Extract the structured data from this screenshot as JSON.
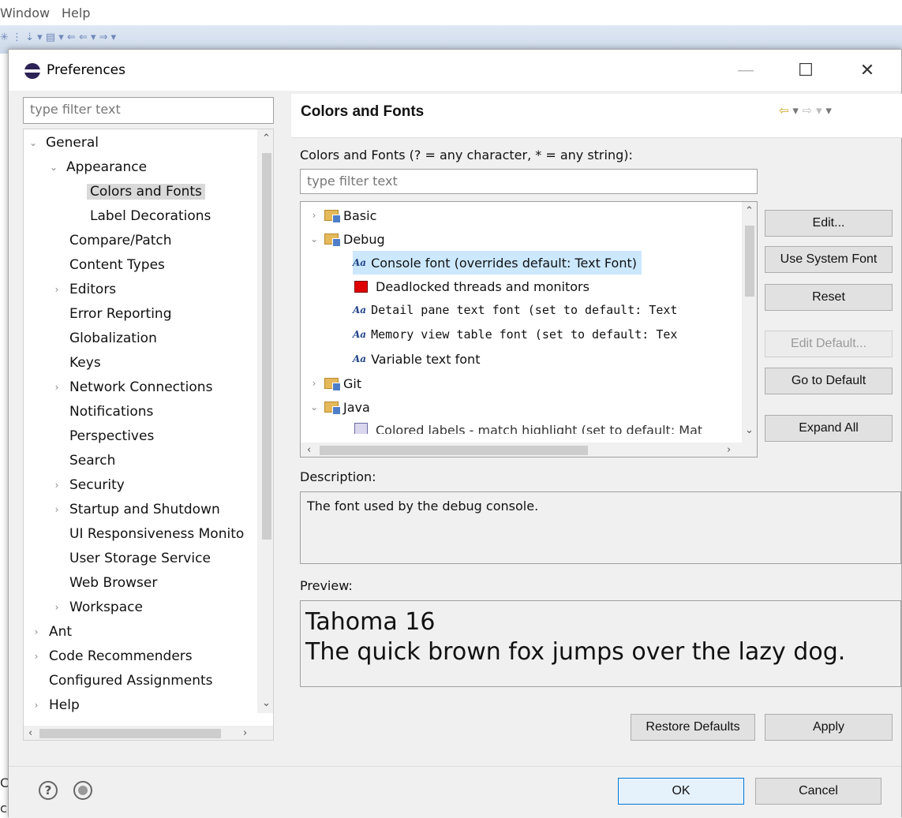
{
  "ide": {
    "menu": [
      "Window",
      "Help"
    ],
    "left_edge_letters": [
      "C",
      "c"
    ]
  },
  "dialog": {
    "title": "Preferences",
    "window_controls": [
      "minimize",
      "maximize",
      "close"
    ]
  },
  "left": {
    "filter_placeholder": "type filter text",
    "tree": [
      {
        "label": "General",
        "level": 0,
        "state": "expanded"
      },
      {
        "label": "Appearance",
        "level": 1,
        "state": "expanded"
      },
      {
        "label": "Colors and Fonts",
        "level": 2,
        "state": "leaf",
        "selected": true
      },
      {
        "label": "Label Decorations",
        "level": 2,
        "state": "leaf"
      },
      {
        "label": "Compare/Patch",
        "level": 1,
        "state": "leaf"
      },
      {
        "label": "Content Types",
        "level": 1,
        "state": "leaf"
      },
      {
        "label": "Editors",
        "level": 1,
        "state": "collapsed"
      },
      {
        "label": "Error Reporting",
        "level": 1,
        "state": "leaf"
      },
      {
        "label": "Globalization",
        "level": 1,
        "state": "leaf"
      },
      {
        "label": "Keys",
        "level": 1,
        "state": "leaf"
      },
      {
        "label": "Network Connections",
        "level": 1,
        "state": "collapsed"
      },
      {
        "label": "Notifications",
        "level": 1,
        "state": "leaf"
      },
      {
        "label": "Perspectives",
        "level": 1,
        "state": "leaf"
      },
      {
        "label": "Search",
        "level": 1,
        "state": "leaf"
      },
      {
        "label": "Security",
        "level": 1,
        "state": "collapsed"
      },
      {
        "label": "Startup and Shutdown",
        "level": 1,
        "state": "collapsed"
      },
      {
        "label": "UI Responsiveness Monito",
        "level": 1,
        "state": "leaf"
      },
      {
        "label": "User Storage Service",
        "level": 1,
        "state": "leaf"
      },
      {
        "label": "Web Browser",
        "level": 1,
        "state": "leaf"
      },
      {
        "label": "Workspace",
        "level": 1,
        "state": "collapsed"
      },
      {
        "label": "Ant",
        "level": 0,
        "state": "collapsed"
      },
      {
        "label": "Code Recommenders",
        "level": 0,
        "state": "collapsed"
      },
      {
        "label": "Configured Assignments",
        "level": 0,
        "state": "leaf"
      },
      {
        "label": "Help",
        "level": 0,
        "state": "collapsed"
      }
    ]
  },
  "right": {
    "title": "Colors and Fonts",
    "filter_label": "Colors and Fonts (? = any character, * = any string):",
    "filter_placeholder": "type filter text",
    "tree": [
      {
        "label": "Basic",
        "kind": "category",
        "state": "collapsed"
      },
      {
        "label": "Debug",
        "kind": "category",
        "state": "expanded"
      },
      {
        "label": "Console font (overrides default: Text Font)",
        "kind": "font",
        "selected": true
      },
      {
        "label": "Deadlocked threads and monitors",
        "kind": "color",
        "color": "#e00000"
      },
      {
        "label": "Detail pane text font (set to default: Text",
        "kind": "font",
        "mono": true
      },
      {
        "label": "Memory view table font (set to default: Tex",
        "kind": "font",
        "mono": true
      },
      {
        "label": "Variable text font",
        "kind": "font"
      },
      {
        "label": "Git",
        "kind": "category",
        "state": "collapsed"
      },
      {
        "label": "Java",
        "kind": "category",
        "state": "expanded"
      },
      {
        "label": "Colored labels - match highlight (set to default: Mat",
        "kind": "color",
        "color": "#dad6ee"
      }
    ],
    "buttons": {
      "edit": "Edit...",
      "use_system_font": "Use System Font",
      "reset": "Reset",
      "edit_default": "Edit Default...",
      "go_to_default": "Go to Default",
      "expand_all": "Expand All"
    },
    "description_label": "Description:",
    "description_text": "The font used by the debug console.",
    "preview_label": "Preview:",
    "preview_line1": "Tahoma 16",
    "preview_line2": "The quick brown fox jumps over the lazy dog.",
    "restore_defaults": "Restore Defaults",
    "apply": "Apply"
  },
  "footer": {
    "ok": "OK",
    "cancel": "Cancel"
  }
}
